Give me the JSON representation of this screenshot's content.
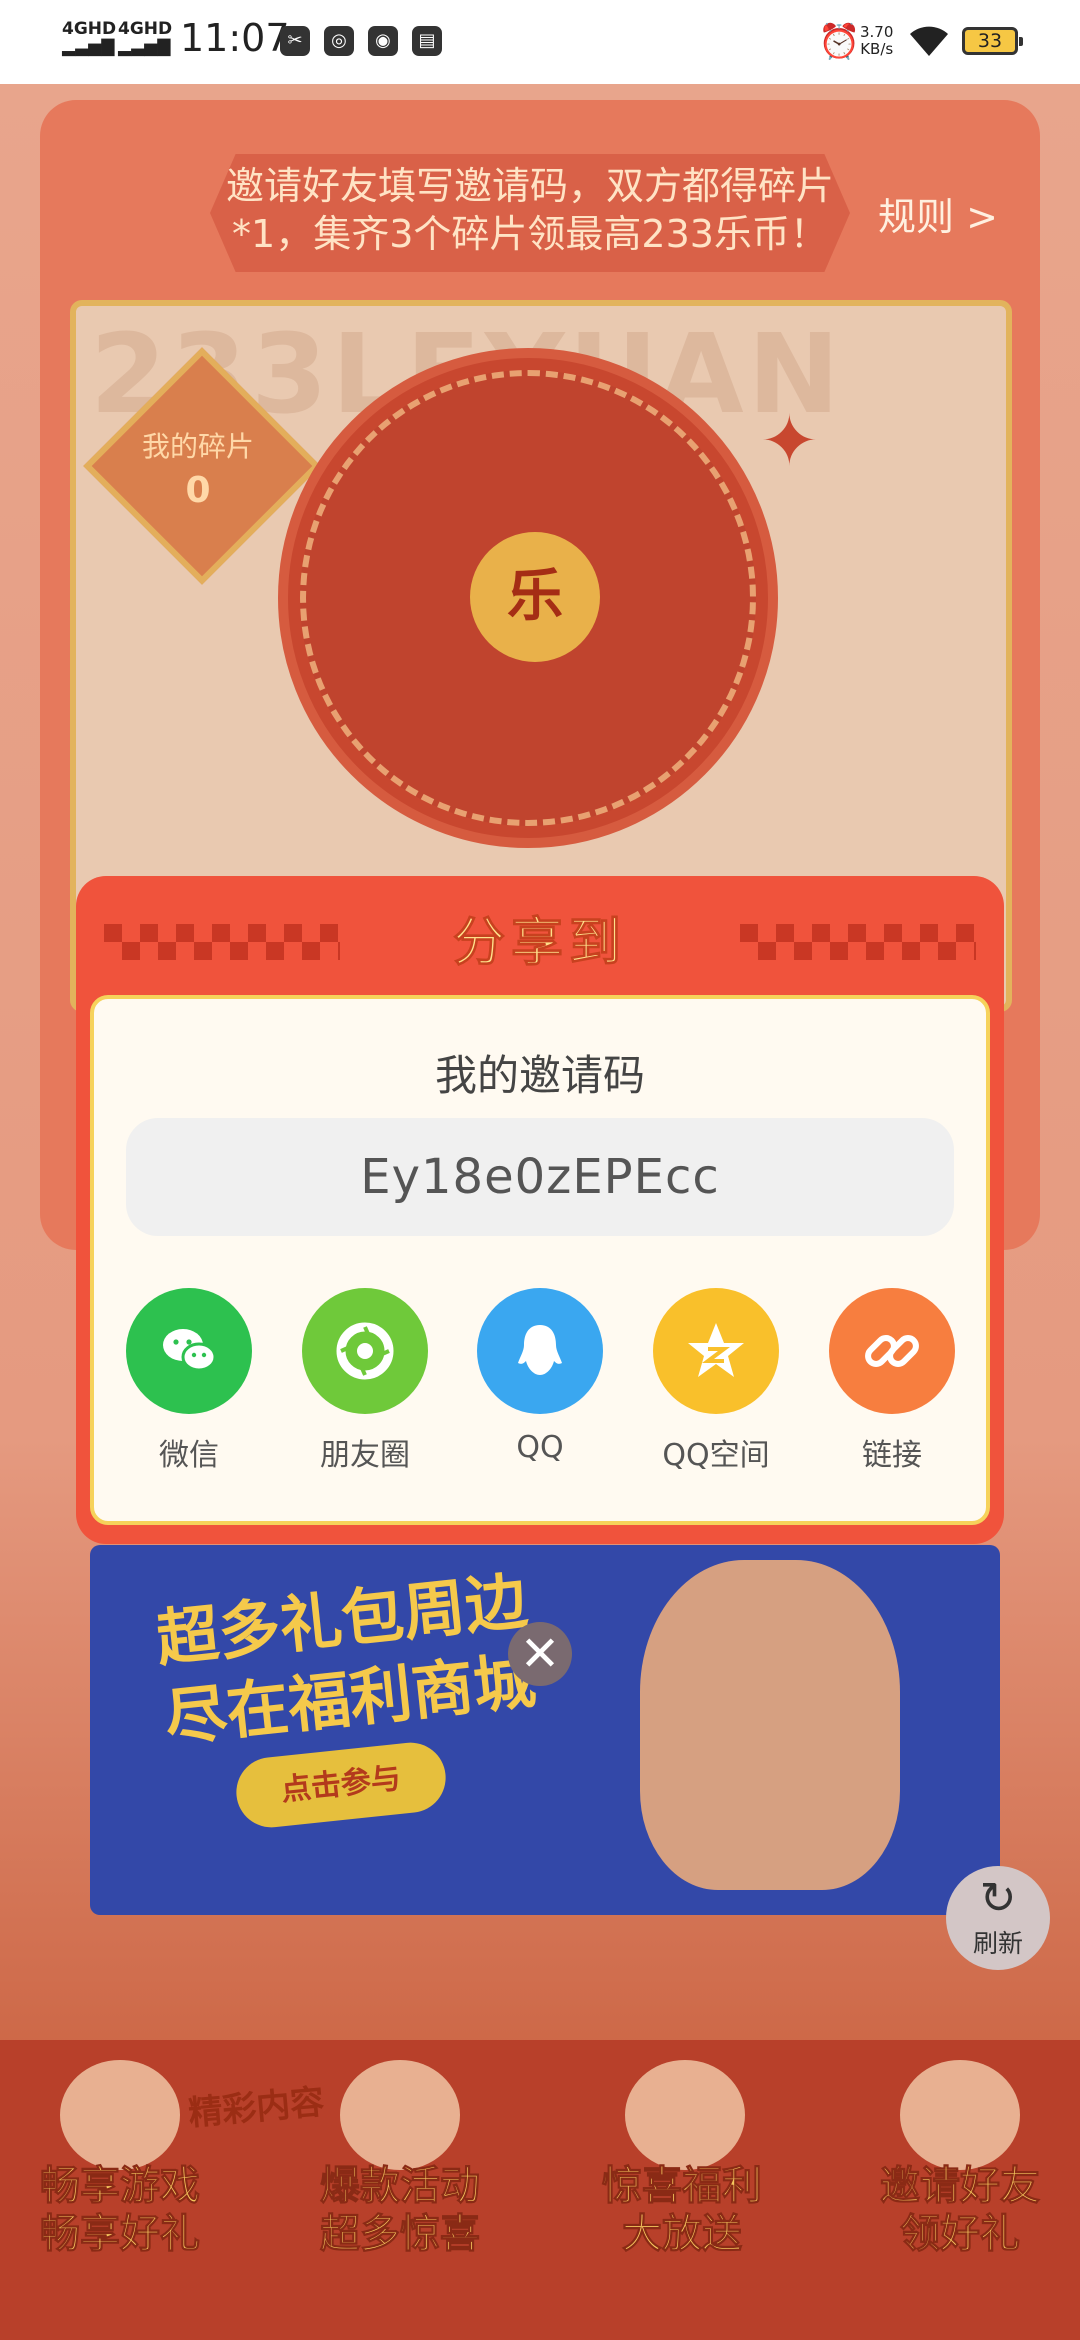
{
  "status_bar": {
    "network_1": "4GHD",
    "network_2": "4GHD",
    "time": "11:07",
    "net_speed_value": "3.70",
    "net_speed_unit": "KB/s",
    "battery": "33"
  },
  "page": {
    "invite_banner_line1": "邀请好友填写邀请码，双方都得碎片",
    "invite_banner_line2": "*1，集齐3个碎片领最高233乐币！",
    "rules_link": "规则 >",
    "watermark": "233LEYUAN",
    "my_shards_label": "我的碎片",
    "my_shards_count": "0",
    "wheel_center": "乐",
    "mall_title_line1": "超多礼包周边",
    "mall_title_line2": "尽在福利商城",
    "mall_button": "点击参与",
    "refresh_label": "刷新",
    "featured_tag": "精彩内容",
    "bottom_nav": [
      {
        "line1": "畅享游戏",
        "line2": "畅享好礼"
      },
      {
        "line1": "爆款活动",
        "line2": "超多惊喜"
      },
      {
        "line1": "惊喜福利",
        "line2": "大放送"
      },
      {
        "line1": "邀请好友",
        "line2": "领好礼"
      }
    ]
  },
  "dialog": {
    "title": "分享到",
    "code_label": "我的邀请码",
    "invite_code": "Ey18e0zEPEcc",
    "share_targets": [
      {
        "label": "微信",
        "icon": "wechat-icon",
        "color": "#2dc14f"
      },
      {
        "label": "朋友圈",
        "icon": "moments-icon",
        "color": "#6fc93a"
      },
      {
        "label": "QQ",
        "icon": "qq-icon",
        "color": "#3aa7f0"
      },
      {
        "label": "QQ空间",
        "icon": "qzone-icon",
        "color": "#f9c02b"
      },
      {
        "label": "链接",
        "icon": "link-icon",
        "color": "#f77e3f"
      }
    ]
  }
}
